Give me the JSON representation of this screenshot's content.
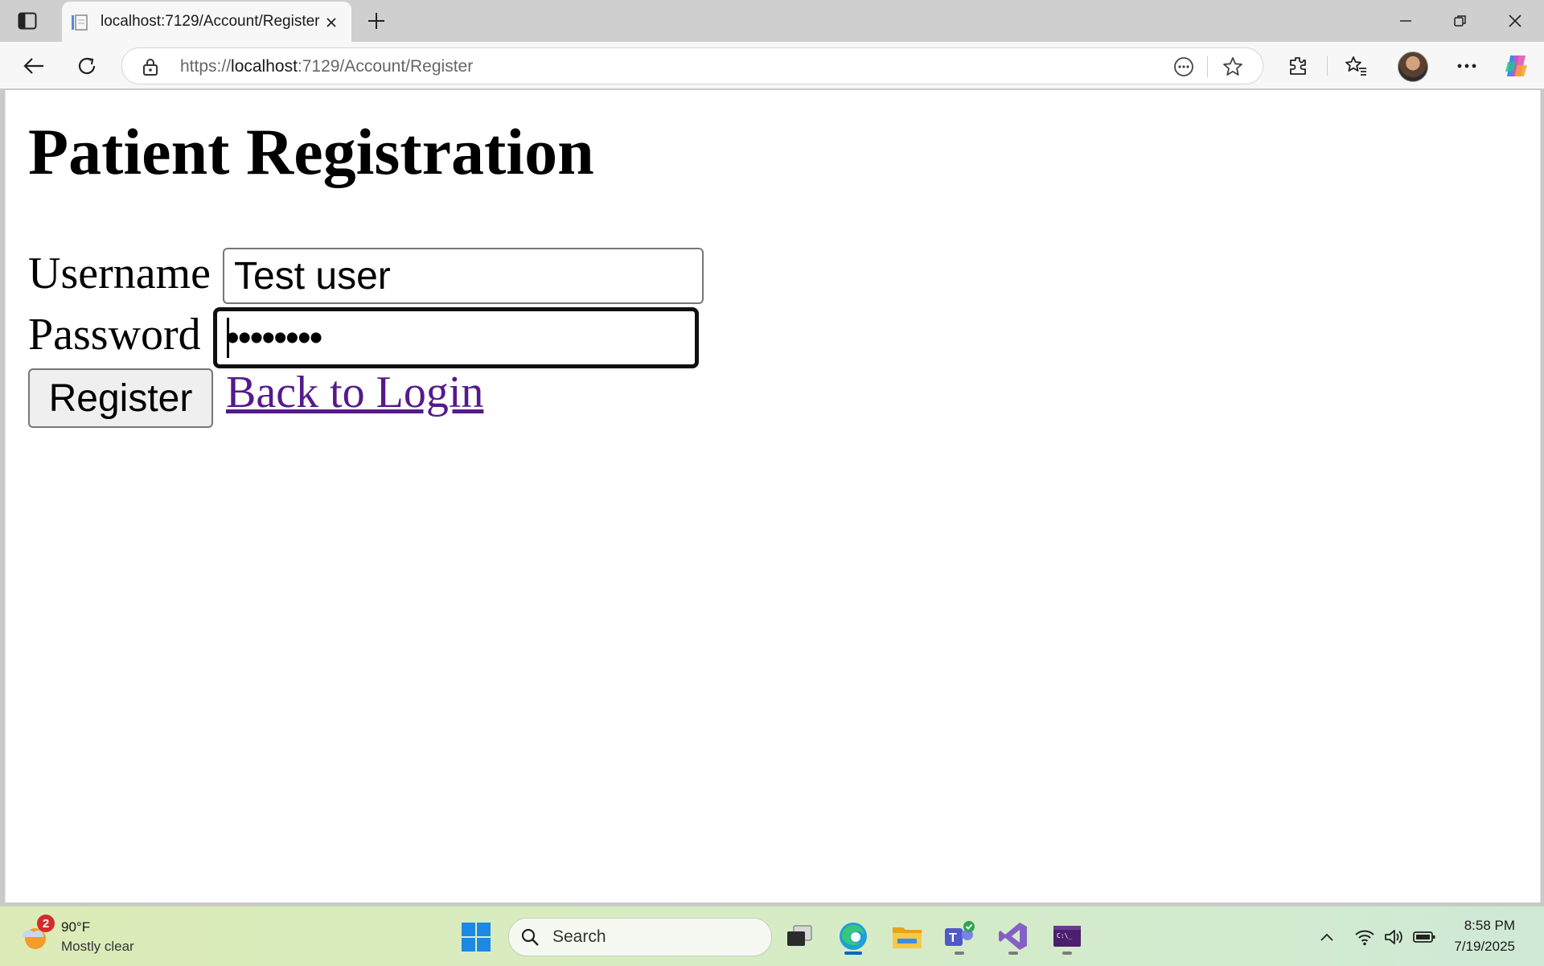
{
  "browser": {
    "tab_title": "localhost:7129/Account/Register",
    "url_prefix": "https://",
    "url_host": "localhost",
    "url_rest": ":7129/Account/Register"
  },
  "page": {
    "title": "Patient Registration",
    "username_label": "Username",
    "username_value": "Test user",
    "password_label": "Password",
    "password_value": "••••••••",
    "register_label": "Register",
    "back_link": "Back to Login"
  },
  "taskbar": {
    "weather_temp": "90°F",
    "weather_desc": "Mostly clear",
    "weather_badge": "2",
    "search_placeholder": "Search",
    "time": "8:58 PM",
    "date": "7/19/2025"
  },
  "colors": {
    "link_visited": "#551a8b",
    "taskbar_accent": "#0067c0"
  }
}
